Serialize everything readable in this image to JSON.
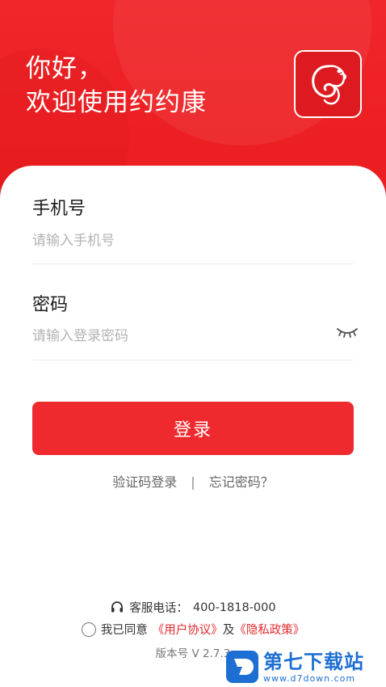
{
  "header": {
    "greeting_line1": "你好，",
    "greeting_line2": "欢迎使用约约康"
  },
  "form": {
    "phone_label": "手机号",
    "phone_placeholder": "请输入手机号",
    "password_label": "密码",
    "password_placeholder": "请输入登录密码",
    "login_button": "登录"
  },
  "links": {
    "sms_login": "验证码登录",
    "separator": "|",
    "forgot_password": "忘记密码？"
  },
  "footer": {
    "service_label": "客服电话：",
    "service_phone": "400-1818-000",
    "agree_prefix": "我已同意",
    "user_agreement": "《用户协议》",
    "and": "及",
    "privacy_policy": "《隐私政策》",
    "version": "版本号 V 2.7.3"
  },
  "watermark": {
    "title": "第七下载站",
    "url": "www.d7down.com"
  },
  "colors": {
    "brand_red": "#ee2a2f",
    "watermark_blue": "#1e6fd3"
  }
}
